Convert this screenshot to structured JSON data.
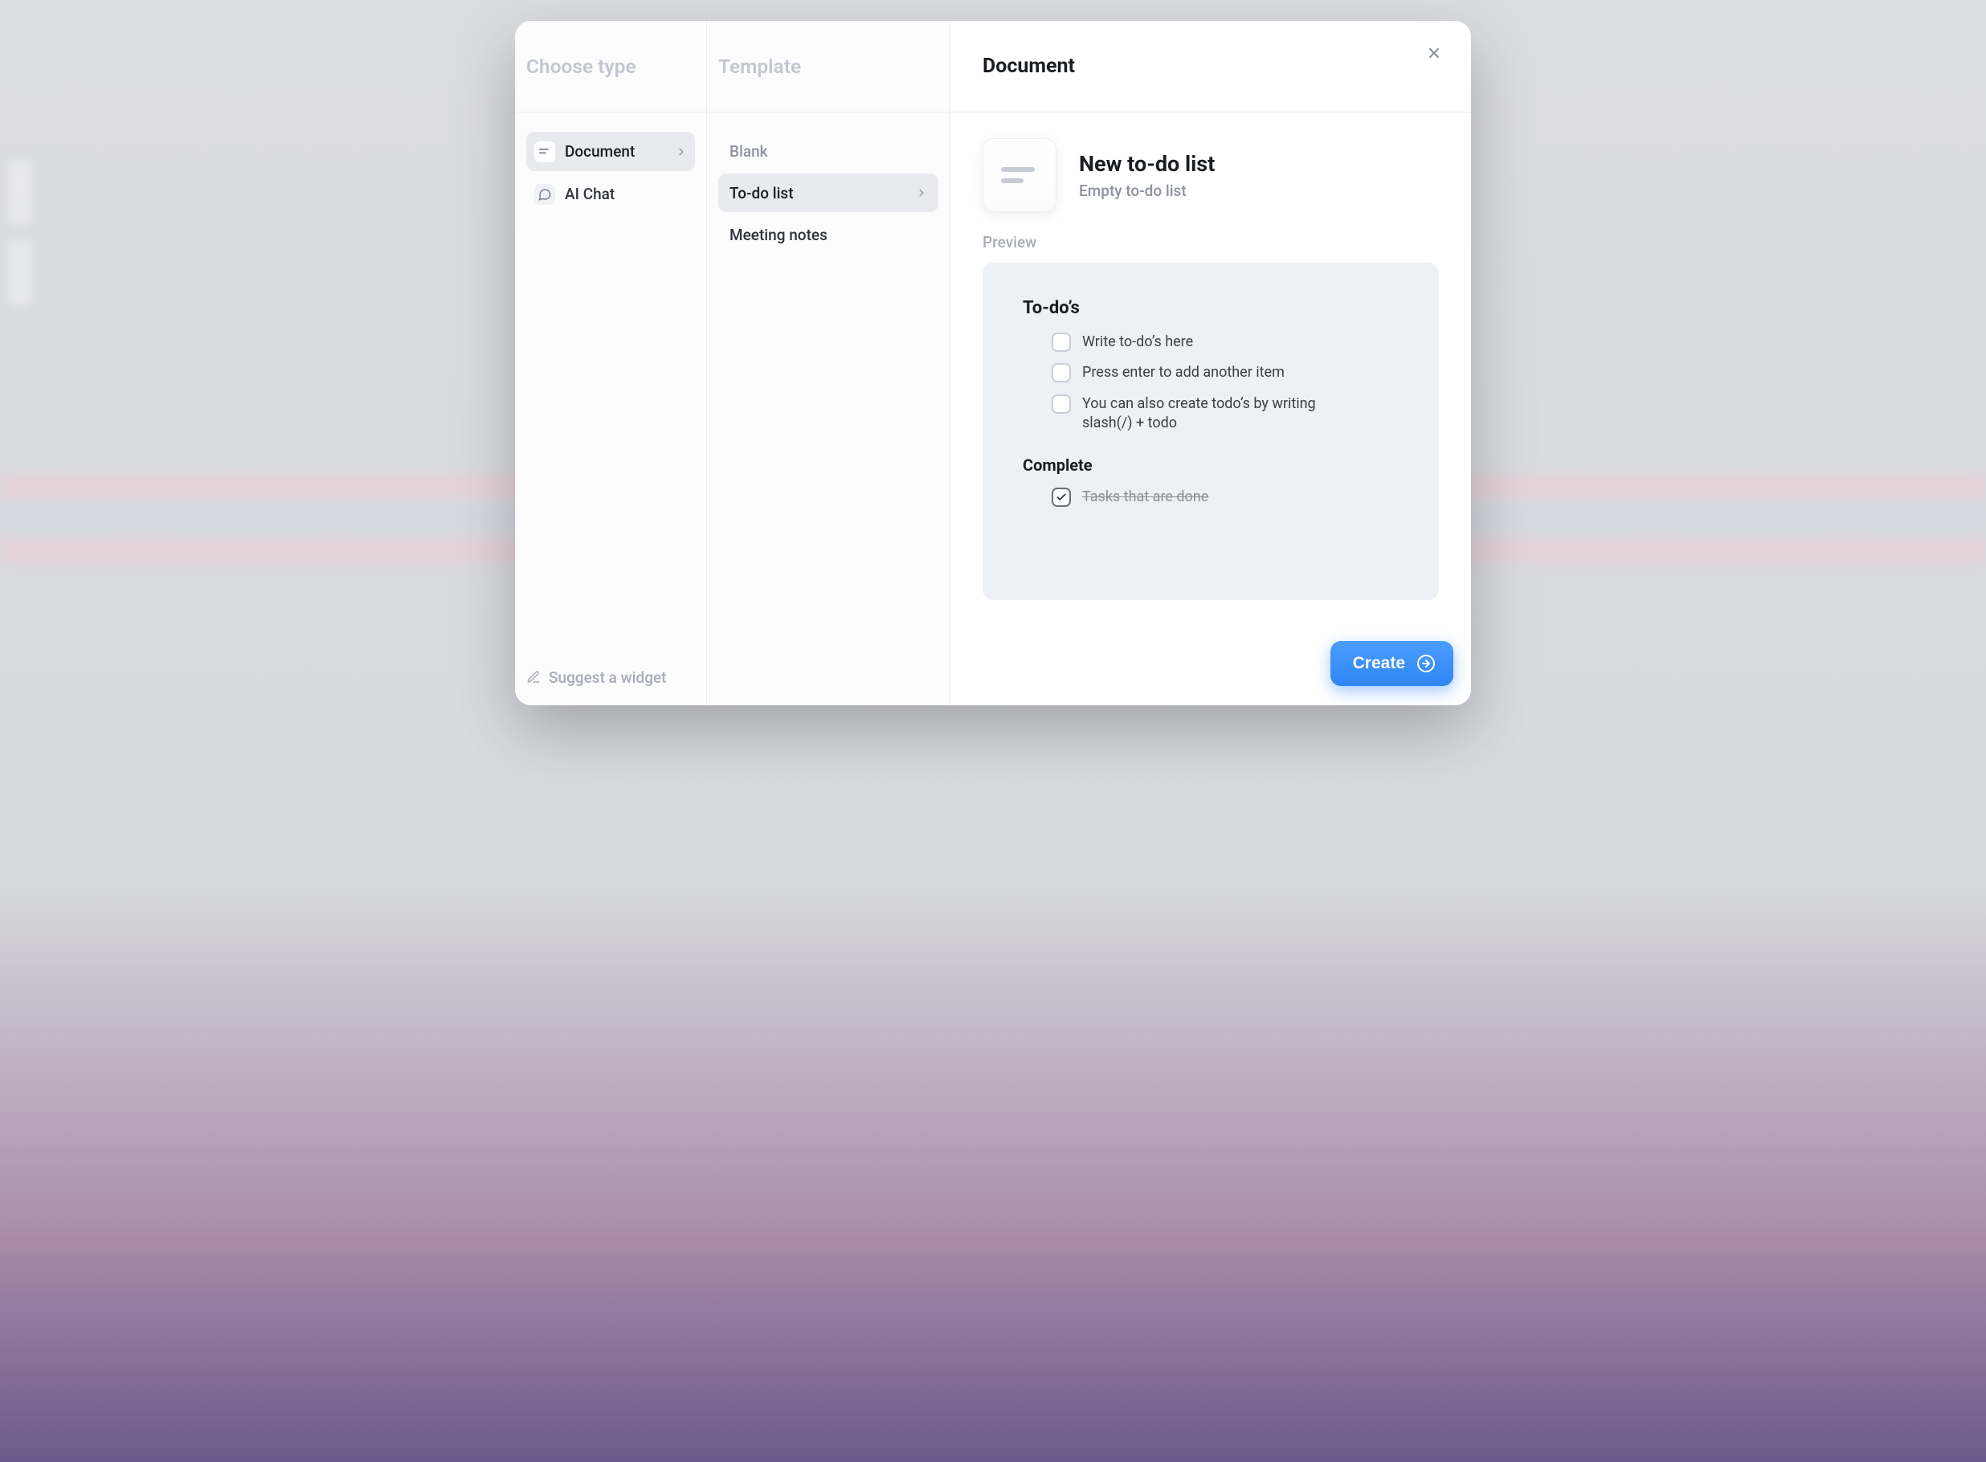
{
  "left": {
    "header": "Choose type",
    "items": [
      {
        "label": "Document",
        "selected": true,
        "icon": "document-icon"
      },
      {
        "label": "AI Chat",
        "selected": false,
        "icon": "chat-icon"
      }
    ],
    "footer": "Suggest a widget"
  },
  "middle": {
    "header": "Template",
    "items": [
      {
        "label": "Blank",
        "selected": false
      },
      {
        "label": "To-do list",
        "selected": true
      },
      {
        "label": "Meeting notes",
        "selected": false
      }
    ]
  },
  "main": {
    "header": "Document",
    "title": "New to-do list",
    "subtitle": "Empty to-do list",
    "preview_label": "Preview",
    "preview": {
      "todos_title": "To-do’s",
      "todos": [
        {
          "text": "Write to-do’s here",
          "done": false
        },
        {
          "text": "Press enter to add another item",
          "done": false
        },
        {
          "text": "You can also create todo’s by writing slash(/) + todo",
          "done": false
        }
      ],
      "complete_title": "Complete",
      "complete": [
        {
          "text": "Tasks that are done",
          "done": true
        }
      ]
    },
    "create_button": "Create"
  }
}
